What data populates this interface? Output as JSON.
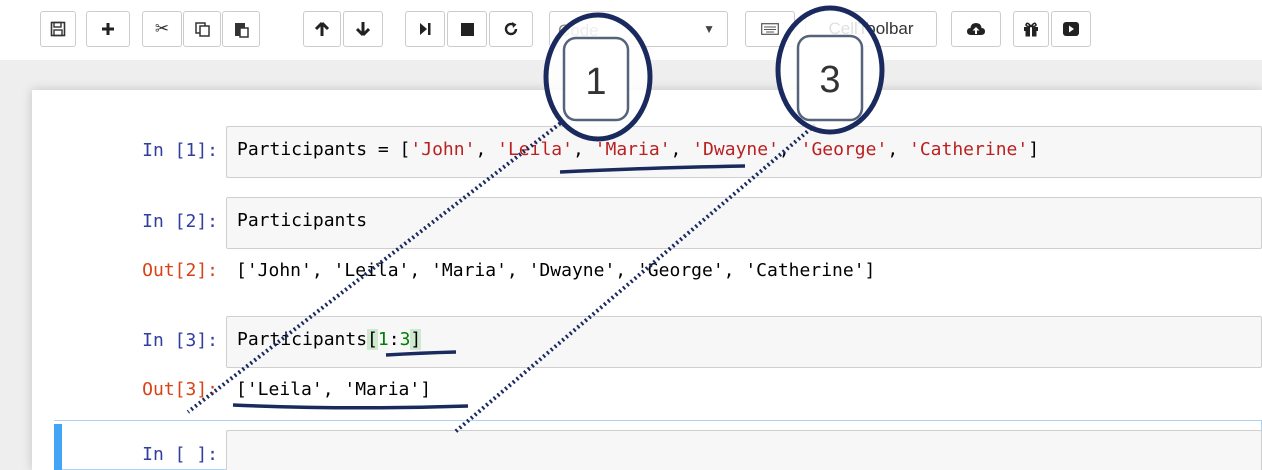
{
  "toolbar": {
    "icons": [
      "save-icon",
      "plus-icon",
      "scissors-icon",
      "copy-icon",
      "paste-icon",
      "arrow-up-icon",
      "arrow-down-icon",
      "run-next-icon",
      "stop-icon",
      "restart-icon",
      "keyboard-icon",
      "cloud-upload-icon",
      "gift-icon",
      "youtube-icon"
    ],
    "cell_type": "Code",
    "celltoolbar_label": "CellToolbar"
  },
  "cells": [
    {
      "in_prompt": "In [1]:",
      "code": "Participants = ['John', 'Leila', 'Maria', 'Dwayne', 'George', 'Catherine']"
    },
    {
      "in_prompt": "In [2]:",
      "code": "Participants",
      "out_prompt": "Out[2]:",
      "output": "['John', 'Leila', 'Maria', 'Dwayne', 'George', 'Catherine']"
    },
    {
      "in_prompt": "In [3]:",
      "code": "Participants[1:3]",
      "out_prompt": "Out[3]:",
      "output": "['Leila', 'Maria']"
    },
    {
      "in_prompt": "In [ ]:",
      "code": ""
    }
  ],
  "cell1": {
    "tok_name": "Participants",
    "tok_eq": " = [",
    "tok_s1": "'John'",
    "tok_c1": ", ",
    "tok_s2": "'Leila'",
    "tok_c2": ", ",
    "tok_s3": "'Maria'",
    "tok_c3": ", ",
    "tok_s4": "'Dwayne'",
    "tok_c4": ", ",
    "tok_s5": "'George'",
    "tok_c5": ", ",
    "tok_s6": "'Catherine'",
    "tok_end": "]"
  },
  "cell3": {
    "tok_name": "Participants",
    "tok_open": "[",
    "tok_n1": "1",
    "tok_colon": ":",
    "tok_n2": "3",
    "tok_close": "]"
  },
  "annotations": {
    "label_left": "1",
    "label_right": "3",
    "ink_color": "#1a2a5e"
  },
  "colors": {
    "prompt_in": "#303f9f",
    "prompt_out": "#d84315",
    "string": "#ba2121",
    "number": "#008000",
    "selected_bar": "#42a5f5"
  }
}
